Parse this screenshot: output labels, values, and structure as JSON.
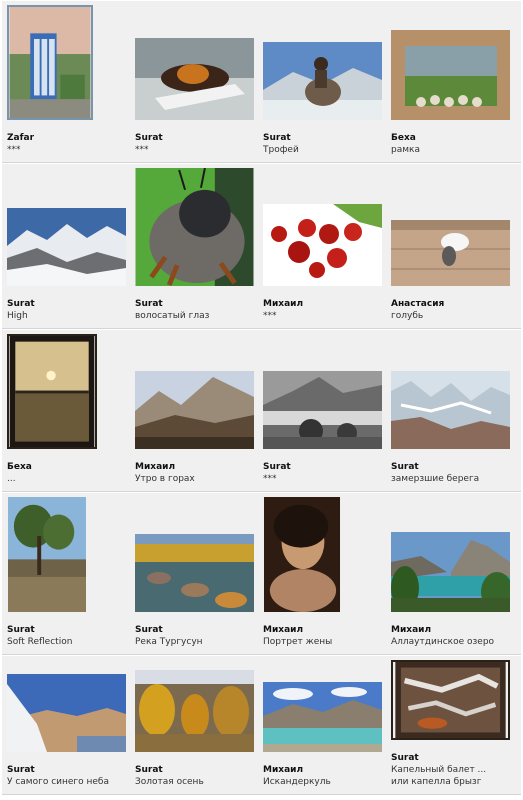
{
  "rows": [
    {
      "items": [
        {
          "author": "Zafar",
          "title": "***"
        },
        {
          "author": "Surat",
          "title": "***"
        },
        {
          "author": "Surat",
          "title": "Трофей"
        },
        {
          "author": "Беха",
          "title": "рамка"
        }
      ]
    },
    {
      "items": [
        {
          "author": "Surat",
          "title": "High"
        },
        {
          "author": "Surat",
          "title": "волосатый глаз"
        },
        {
          "author": "Михаил",
          "title": "***"
        },
        {
          "author": "Анастасия",
          "title": "голубь"
        }
      ]
    },
    {
      "items": [
        {
          "author": "Беха",
          "title": "..."
        },
        {
          "author": "Михаил",
          "title": "Утро в горах"
        },
        {
          "author": "Surat",
          "title": "***"
        },
        {
          "author": "Surat",
          "title": "замерзшие берега"
        }
      ]
    },
    {
      "items": [
        {
          "author": "Surat",
          "title": "Soft Reflection"
        },
        {
          "author": "Surat",
          "title": "Река Тургусун"
        },
        {
          "author": "Михаил",
          "title": "Портрет жены"
        },
        {
          "author": "Михаил",
          "title": "Аллаутдинское озеро"
        }
      ]
    },
    {
      "items": [
        {
          "author": "Surat",
          "title": "У самого синего неба"
        },
        {
          "author": "Surat",
          "title": "Золотая осень"
        },
        {
          "author": "Михаил",
          "title": "Искандеркуль"
        },
        {
          "author": "Surat",
          "title": "Капельный балет ...\nили капелла брызг"
        }
      ]
    }
  ]
}
